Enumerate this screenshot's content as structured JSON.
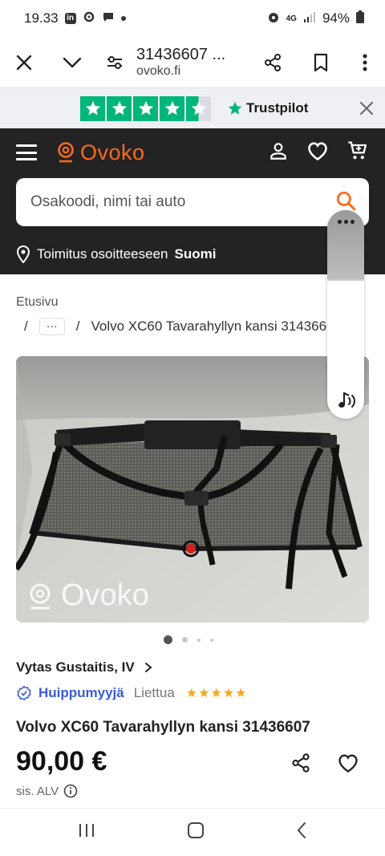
{
  "status_bar": {
    "time": "19.33",
    "battery": "94%",
    "network": "4G"
  },
  "browser": {
    "page_title": "31436607 ...",
    "domain": "ovoko.fi"
  },
  "trustpilot": {
    "brand": "Trustpilot",
    "rating_stars": 4.5
  },
  "header": {
    "logo_text": "Ovoko",
    "search_placeholder": "Osakoodi, nimi tai auto",
    "delivery_prefix": "Toimitus osoitteeseen",
    "delivery_country": "Suomi"
  },
  "breadcrumb": {
    "home": "Etusivu",
    "separator": "/",
    "ellipsis": "···",
    "current": "Volvo XC60 Tavarahyllyn kansi 31436607"
  },
  "gallery": {
    "watermark": "Ovoko",
    "current_index": 1,
    "total_dots": 4
  },
  "seller": {
    "name": "Vytas Gustaitis, IV",
    "badge": "Huippumyyjä",
    "country": "Liettua",
    "rating_stars": "★★★★★"
  },
  "product": {
    "title": "Volvo XC60 Tavarahyllyn kansi 31436607",
    "price": "90,00 €",
    "vat_note": "sis. ALV"
  },
  "colors": {
    "brand_orange": "#ff6a1f",
    "header_bg": "#232323",
    "trustpilot_green": "#00b67a",
    "badge_blue": "#3a5bd9"
  }
}
